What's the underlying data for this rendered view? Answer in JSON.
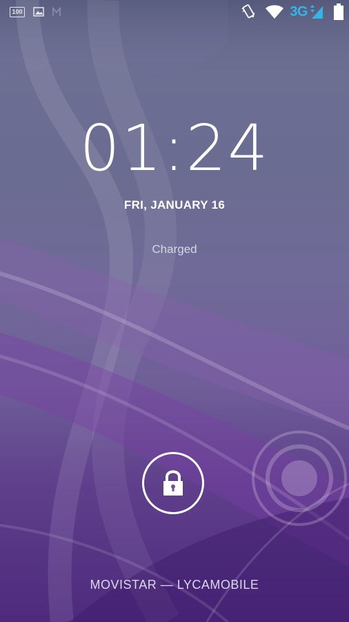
{
  "status_bar": {
    "battery_percent_badge": "100",
    "left_icons": [
      "battery-percent-icon",
      "image-icon",
      "gmail-icon"
    ],
    "right_icons": [
      "vibrate-icon",
      "wifi-icon",
      "mobile-signal-icon",
      "battery-icon"
    ],
    "network_type": "3G",
    "accent_color": "#33b5e5"
  },
  "lockscreen": {
    "time": "01:24",
    "date": "FRI, JANUARY 16",
    "charge_status": "Charged",
    "carrier": "MOVISTAR — LYCAMOBILE",
    "unlock_icon": "lock-icon",
    "camera_hint_icon": "camera-target-icon"
  }
}
